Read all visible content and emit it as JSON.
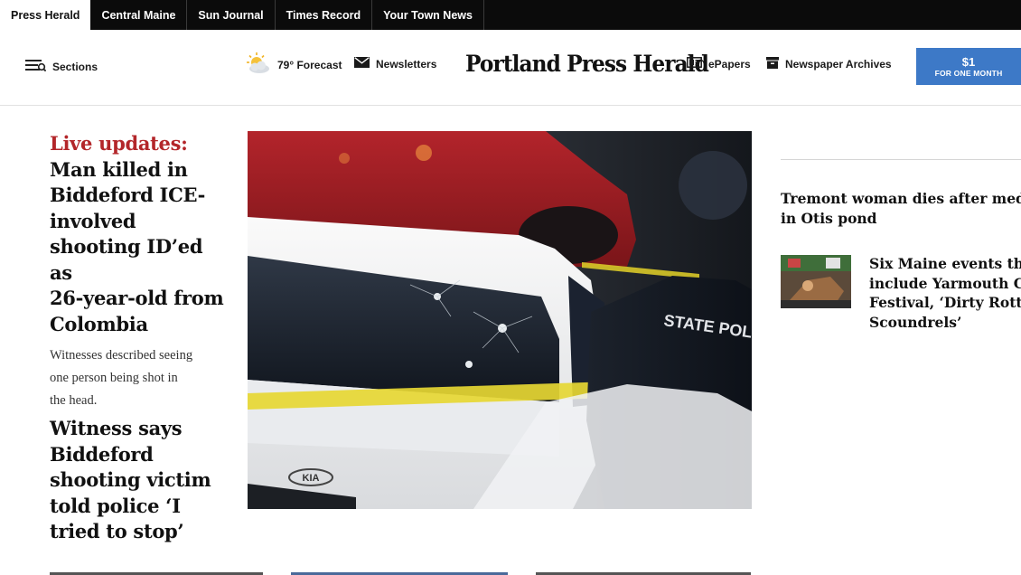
{
  "publications": {
    "tabs": [
      "Press Herald",
      "Central Maine",
      "Sun Journal",
      "Times Record",
      "Your Town News"
    ]
  },
  "header": {
    "sections_label": "Sections",
    "weather_label": "79° Forecast",
    "newsletters_label": "Newsletters",
    "logo_text": "Portland Press Herald",
    "epapers_label": "ePapers",
    "archives_label": "Newspaper Archives",
    "subscribe_price": "$1",
    "subscribe_term": "FOR ONE MONTH"
  },
  "lead": {
    "kicker": "Live updates:",
    "title_lines": [
      "Man killed in",
      "Biddeford ICE-",
      "involved",
      "shooting ID’ed as",
      "26-year-old from",
      "Colombia"
    ],
    "deck_lines": [
      "Witnesses described seeing",
      "one person being shot in",
      "the head."
    ]
  },
  "second_story": {
    "title_lines": [
      "Witness says",
      "Biddeford",
      "shooting victim",
      "told police ‘I",
      "tried to stop’"
    ]
  },
  "main_photo": {
    "car_badge": "KIA",
    "vest_text": "STATE POLIC"
  },
  "rail": {
    "story1_lines": [
      "Tremont woman dies after medica",
      "in Otis pond"
    ],
    "story2_lines": [
      "Six Maine events this",
      "include Yarmouth Cl",
      "Festival, ‘Dirty Rotter",
      "Scoundrels’"
    ]
  },
  "icons": {
    "sections": "menu-icon",
    "weather": "partly-sunny-icon",
    "newsletters": "envelope-icon",
    "epapers": "newspaper-icon",
    "archives": "archive-box-icon"
  },
  "colors": {
    "kicker_red": "#b3262a",
    "subscribe_blue": "#3d79c7",
    "topbar_black": "#0b0b0b"
  }
}
